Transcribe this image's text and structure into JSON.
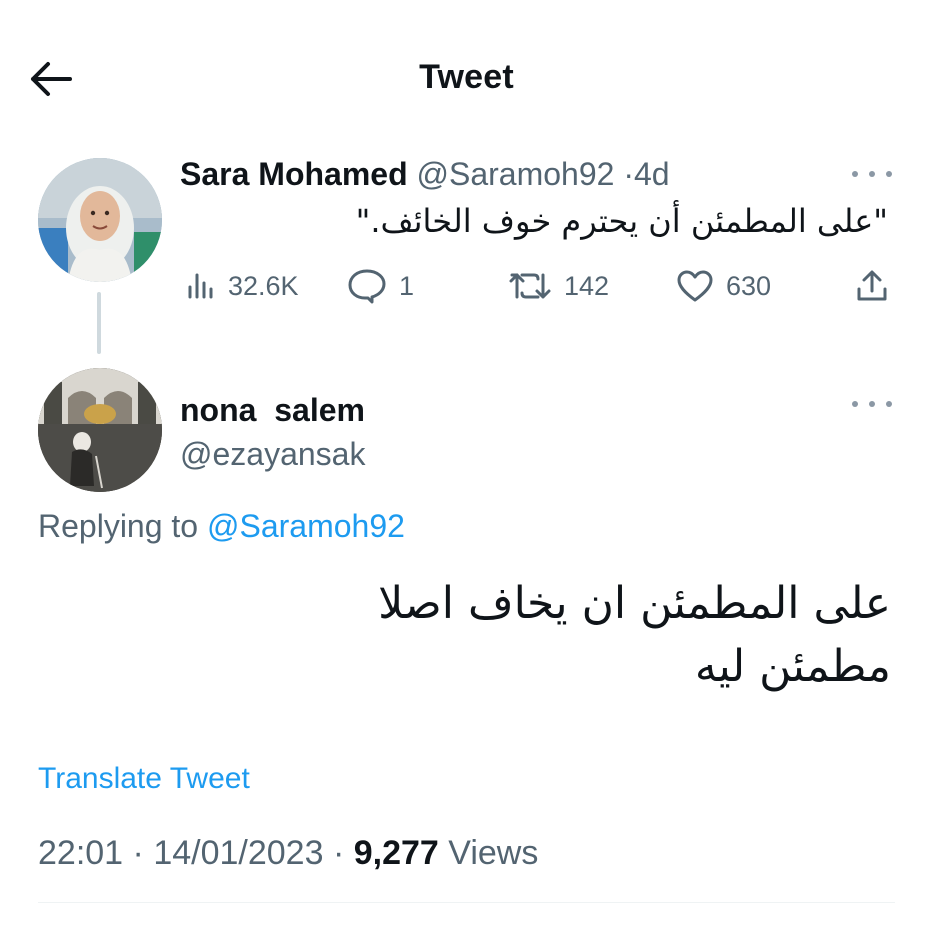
{
  "header": {
    "title": "Tweet",
    "back_icon": "arrow-left-icon"
  },
  "parent_tweet": {
    "display_name": "Sara Mohamed",
    "handle": "@Saramoh92",
    "separator": "·",
    "age": "4d",
    "text": "\"على المطمئن أن يحترم خوف الخائف.\"",
    "stats": {
      "views": "32.6K",
      "replies": "1",
      "retweets": "142",
      "likes": "630"
    }
  },
  "reply_tweet": {
    "display_name": "nona  salem",
    "handle": "@ezayansak",
    "replying_prefix": "Replying to ",
    "replying_to": "@Saramoh92",
    "text_lines": [
      "على المطمئن ان يخاف اصلا",
      "مطمئن ليه"
    ],
    "translate_label": "Translate Tweet",
    "time": "22:01",
    "date": "14/01/2023",
    "separator": "·",
    "views_count": "9,277",
    "views_label": "Views"
  },
  "colors": {
    "text": "#0f1419",
    "muted": "#536471",
    "accent": "#1d9bf0",
    "divider": "#eff3f4"
  }
}
